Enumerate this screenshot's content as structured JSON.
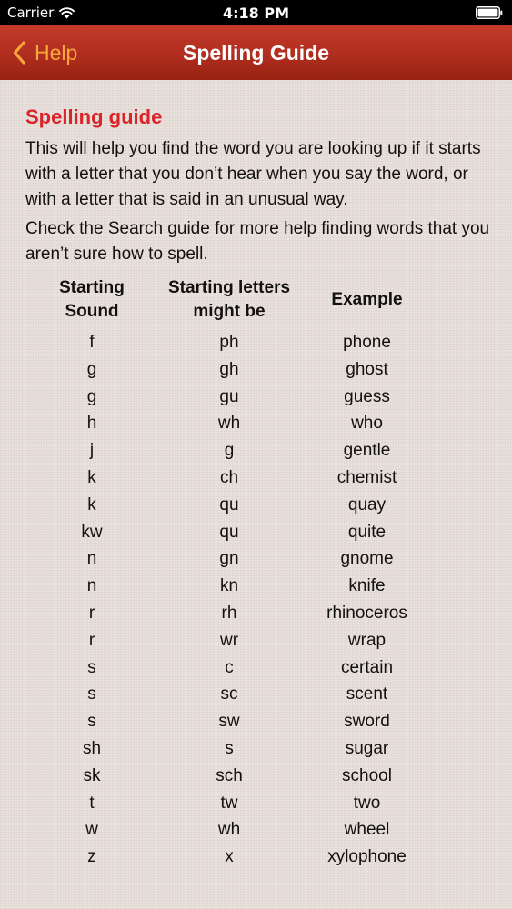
{
  "status_bar": {
    "carrier": "Carrier",
    "time": "4:18 PM",
    "icons": [
      "wifi-icon",
      "battery-icon"
    ]
  },
  "nav": {
    "back_label": "Help",
    "title": "Spelling Guide",
    "back_icon": "chevron-left-icon",
    "colors": {
      "bar": "#b02d1f",
      "back": "#f7a83a",
      "title": "#ffffff"
    }
  },
  "content": {
    "heading": "Spelling guide",
    "heading_color": "#d9242a",
    "intro": "This will help you find the word you are looking up if it starts with a letter that you don’t hear when you say the word, or with a letter that is said in an unusual way.",
    "search_note": "Check the Search guide for more help finding words that you aren’t sure how to spell."
  },
  "table": {
    "headers": [
      "Starting\nSound",
      "Starting letters\nmight be",
      "Example"
    ],
    "header_lines": [
      [
        "Starting",
        "Sound"
      ],
      [
        "Starting letters",
        "might be"
      ],
      [
        "Example"
      ]
    ],
    "rows": [
      [
        "f",
        "ph",
        "phone"
      ],
      [
        "g",
        "gh",
        "ghost"
      ],
      [
        "g",
        "gu",
        "guess"
      ],
      [
        "h",
        "wh",
        "who"
      ],
      [
        "j",
        "g",
        "gentle"
      ],
      [
        "k",
        "ch",
        "chemist"
      ],
      [
        "k",
        "qu",
        "quay"
      ],
      [
        "kw",
        "qu",
        "quite"
      ],
      [
        "n",
        "gn",
        "gnome"
      ],
      [
        "n",
        "kn",
        "knife"
      ],
      [
        "r",
        "rh",
        "rhinoceros"
      ],
      [
        "r",
        "wr",
        "wrap"
      ],
      [
        "s",
        "c",
        "certain"
      ],
      [
        "s",
        "sc",
        "scent"
      ],
      [
        "s",
        "sw",
        "sword"
      ],
      [
        "sh",
        "s",
        "sugar"
      ],
      [
        "sk",
        "sch",
        "school"
      ],
      [
        "t",
        "tw",
        "two"
      ],
      [
        "w",
        "wh",
        "wheel"
      ],
      [
        "z",
        "x",
        "xylophone"
      ]
    ]
  }
}
